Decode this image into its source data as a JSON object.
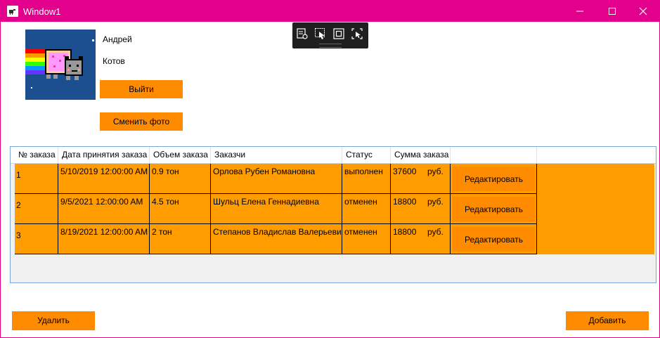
{
  "window": {
    "title": "Window1"
  },
  "titlebar_icons": {
    "app": "app-icon",
    "minimize": "minimize-icon",
    "maximize": "maximize-icon",
    "close": "close-icon"
  },
  "colors": {
    "titlebar": "#e3008c",
    "button": "#ff8c00",
    "row": "#ff9c00",
    "grid_border": "#7aa6d6"
  },
  "profile": {
    "first_name": "Андрей",
    "last_name": "Котов",
    "logout_label": "Выйти",
    "change_photo_label": "Сменить фото"
  },
  "debug_toolbar": {
    "icons": [
      "live-visual-tree-icon",
      "select-element-icon",
      "display-layout-adorners-icon",
      "track-focused-element-icon"
    ]
  },
  "table": {
    "columns": [
      "№ заказа",
      "Дата принятия заказа",
      "Объем заказа",
      "Заказчи",
      "Статус",
      "Сумма заказа"
    ],
    "rows": [
      {
        "id": "1",
        "date": "5/10/2019 12:00:00 AM",
        "volume": "0.9 тон",
        "customer": "Орлова Рубен Романовна",
        "status": "выполнен",
        "sum": "37600",
        "currency": "руб.",
        "edit": "Редактировать"
      },
      {
        "id": "2",
        "date": "9/5/2021 12:00:00 AM",
        "volume": "4.5 тон",
        "customer": "Шульц Елена Геннадиевна",
        "status": "отменен",
        "sum": "18800",
        "currency": "руб.",
        "edit": "Редактировать"
      },
      {
        "id": "3",
        "date": "8/19/2021 12:00:00 AM",
        "volume": "2 тон",
        "customer": "Степанов Владислав Валерьевич",
        "status": "отменен",
        "sum": "18800",
        "currency": "руб.",
        "edit": "Редактировать"
      }
    ]
  },
  "footer": {
    "delete_label": "Удалить",
    "add_label": "Добавить"
  }
}
